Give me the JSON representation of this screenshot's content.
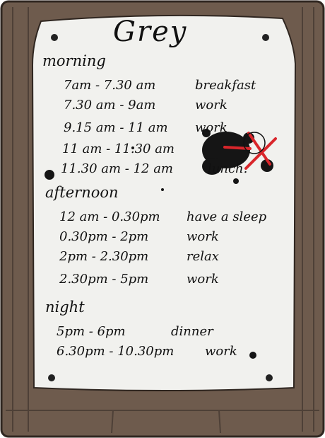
{
  "title": "Grey",
  "sections": [
    {
      "label": "morning",
      "items": [
        {
          "time": "7am - 7.30 am",
          "activity": "breakfast"
        },
        {
          "time": "7.30 am - 9am",
          "activity": "work"
        },
        {
          "time": "9.15 am - 11 am",
          "activity": "work"
        },
        {
          "time": "11 am - 11.30 am",
          "activity": ""
        },
        {
          "time": "11.30 am - 12 am",
          "activity": "lunch."
        }
      ]
    },
    {
      "label": "afternoon",
      "items": [
        {
          "time": "12 am - 0.30pm",
          "activity": "have a sleep"
        },
        {
          "time": "0.30pm - 2pm",
          "activity": "work"
        },
        {
          "time": "2pm - 2.30pm",
          "activity": "relax"
        },
        {
          "time": "2.30pm - 5pm",
          "activity": "work"
        }
      ]
    },
    {
      "label": "night",
      "items": [
        {
          "time": "5pm - 6pm",
          "activity": "dinner"
        },
        {
          "time": "6.30pm - 10.30pm",
          "activity": "work"
        }
      ]
    }
  ],
  "colors": {
    "wood": "#6e5b4d",
    "paper": "#f1f1ee",
    "ink": "#111111",
    "cross": "#d9262b"
  }
}
